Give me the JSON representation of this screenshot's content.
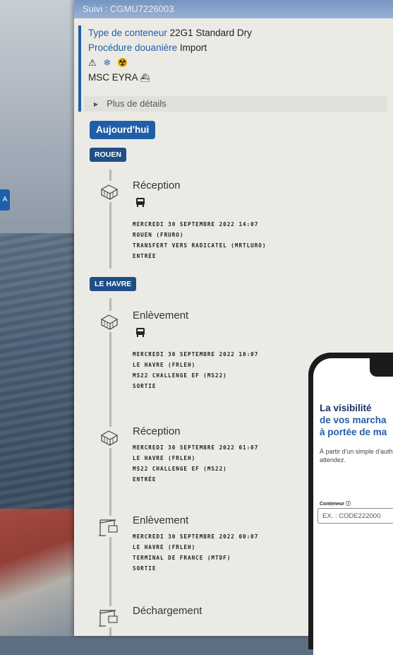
{
  "header": {
    "title": "Suivi : CGMU7226003"
  },
  "info": {
    "container_type_label": "Type de conteneur",
    "container_type_value": "22G1 Standard Dry",
    "customs_label": "Procédure douanière",
    "customs_value": "Import",
    "vessel": "MSC EYRA",
    "icons": [
      "warning-icon",
      "snowflake-icon",
      "hazard-icon"
    ]
  },
  "details_toggle": "Plus de détails",
  "today_button": "Aujourd'hui",
  "locations": [
    "ROUEN",
    "LE HAVRE"
  ],
  "events": [
    {
      "title": "Réception",
      "icon": "container-icon",
      "transport": "bus-icon",
      "lines": [
        "MERCREDI 30 SEPTEMBRE 2022 14:07",
        "ROUEN (FRURO)",
        "TRANSFERT VERS RADICATEL (MRTLURO)",
        "ENTRÉE"
      ]
    },
    {
      "title": "Enlèvement",
      "icon": "container-icon",
      "transport": "bus-icon",
      "lines": [
        "MERCREDI 30 SEPTEMBRE 2022 10:07",
        "LE HAVRE (FRLEH)",
        "MS22 CHALLENGE EF (MS22)",
        "SORTIE"
      ]
    },
    {
      "title": "Réception",
      "icon": "container-icon",
      "lines": [
        "MERCREDI 30 SEPTEMBRE 2022 01:07",
        "LE HAVRE (FRLEH)",
        "MS22 CHALLENGE EF (MS22)",
        "ENTRÉE"
      ]
    },
    {
      "title": "Enlèvement",
      "icon": "crane-icon",
      "lines": [
        "MERCREDI 30 SEPTEMBRE 2022 00:07",
        "LE HAVRE (FRLEH)",
        "TERMINAL DE FRANCE (MTDF)",
        "SORTIE"
      ]
    },
    {
      "title": "Déchargement",
      "icon": "crane-icon",
      "lines": []
    }
  ],
  "phone": {
    "title_1": "La visibilité",
    "title_2": "de vos marcha",
    "title_3": "à portée de ma",
    "desc": "À partir d'un simple d'authentification, M que vous attendez.",
    "container_label": "Conteneur",
    "container_placeholder": "EX. : CODE222000"
  },
  "left_tab": "A"
}
